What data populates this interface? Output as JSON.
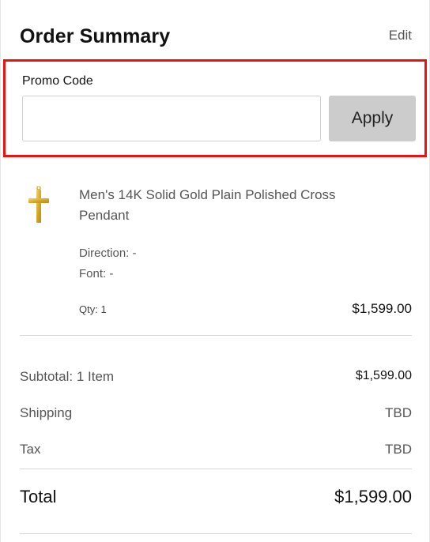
{
  "header": {
    "title": "Order Summary",
    "edit_label": "Edit"
  },
  "promo": {
    "label": "Promo Code",
    "input_value": "",
    "input_placeholder": "",
    "apply_label": "Apply"
  },
  "cart_item": {
    "name": "Men's 14K Solid Gold Plain Polished Cross Pendant",
    "image_icon": "gold-cross-pendant",
    "direction": "Direction: -",
    "font": "Font: -",
    "qty": "Qty: 1",
    "price": "$1,599.00"
  },
  "totals": {
    "subtotal_label": "Subtotal: 1 Item",
    "subtotal_value": "$1,599.00",
    "shipping_label": "Shipping",
    "shipping_value": "TBD",
    "tax_label": "Tax",
    "tax_value": "TBD",
    "total_label": "Total",
    "total_value": "$1,599.00"
  },
  "colors": {
    "highlight_border": "#ee1111",
    "apply_button_bg": "#cccccc",
    "gold": "#d4a92a"
  }
}
